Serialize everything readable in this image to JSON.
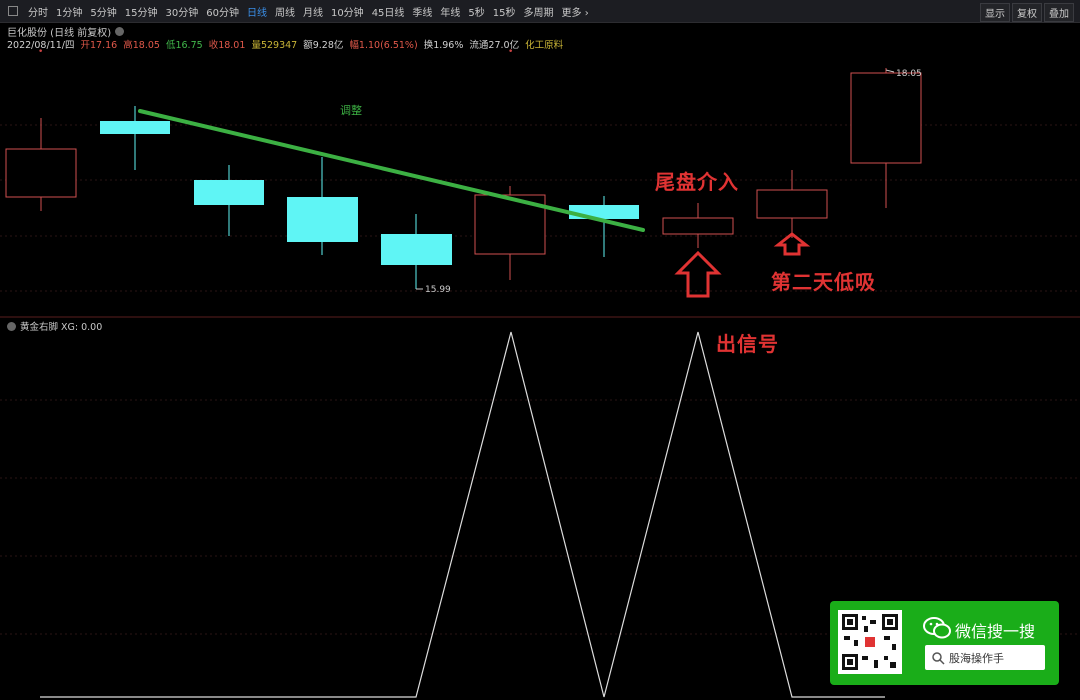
{
  "toolbar": {
    "tabs": [
      "分时",
      "1分钟",
      "5分钟",
      "15分钟",
      "30分钟",
      "60分钟",
      "日线",
      "周线",
      "月线",
      "10分钟",
      "45日线",
      "季线",
      "年线",
      "5秒",
      "15秒",
      "多周期",
      "更多 ›"
    ],
    "active_index": 6,
    "right_buttons": [
      "显示",
      "复权",
      "叠加"
    ]
  },
  "header": {
    "title": "巨化股份 (日线 前复权)",
    "quote": {
      "date": "2022/08/11/四",
      "open": "开17.16",
      "high": "高18.05",
      "low": "低16.75",
      "close": "收18.01",
      "volume": "量529347",
      "amount": "额9.28亿",
      "change": "幅1.10(6.51%)",
      "turnover": "换1.96%",
      "float": "流通27.0亿",
      "industry": "化工原料"
    }
  },
  "main_chart": {
    "trend_label": "调整",
    "low_marker": "15.99",
    "high_marker": "18.05"
  },
  "indicator": {
    "title": "黄金右脚 XG: 0.00"
  },
  "annotations": {
    "tail_entry": "尾盘介入",
    "next_day": "第二天低吸",
    "signal": "出信号"
  },
  "wechat": {
    "title": "微信搜一搜",
    "search_text": "股海操作手"
  },
  "colors": {
    "up": "#e0584a",
    "down": "#5ff5f5",
    "trend": "#3cb043",
    "accent": "#e03333"
  }
}
